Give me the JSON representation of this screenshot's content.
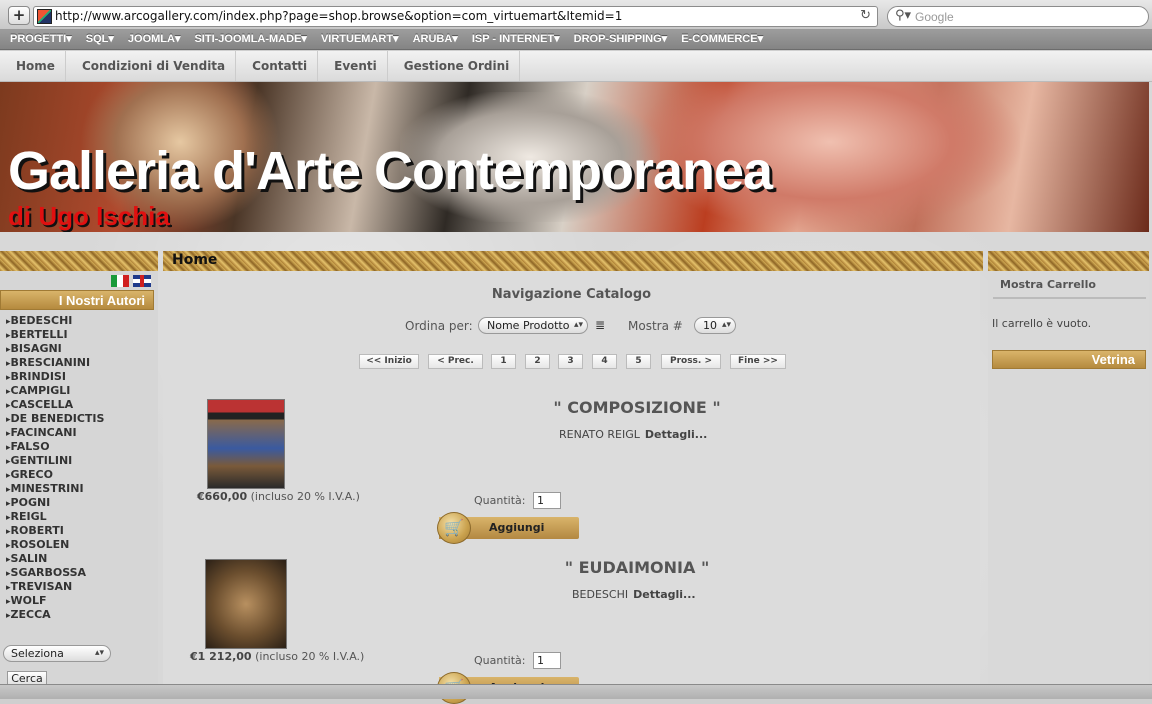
{
  "browser": {
    "url": "http://www.arcogallery.com/index.php?page=shop.browse&option=com_virtuemart&Itemid=1",
    "search_placeholder": "Google",
    "bookmarks": [
      "PROGETTI▾",
      "SQL▾",
      "JOOMLA▾",
      "SITI-JOOMLA-MADE▾",
      "VIRTUEMART▾",
      "ARUBA▾",
      "ISP - INTERNET▾",
      "DROP-SHIPPING▾",
      "E-COMMERCE▾"
    ]
  },
  "nav": [
    "Home",
    "Condizioni di Vendita",
    "Contatti",
    "Eventi",
    "Gestione Ordini"
  ],
  "banner": {
    "title": "Galleria d'Arte Contemporanea",
    "subtitle": "di Ugo Ischia"
  },
  "sidebar": {
    "authors_title": "I Nostri Autori",
    "authors": [
      "BEDESCHI",
      "BERTELLI",
      "BISAGNI",
      "BRESCIANINI",
      "BRINDISI",
      "CAMPIGLI",
      "CASCELLA",
      "DE BENEDICTIS",
      "FACINCANI",
      "FALSO",
      "GENTILINI",
      "GRECO",
      "MINESTRINI",
      "POGNI",
      "REIGL",
      "ROBERTI",
      "ROSOLEN",
      "SALIN",
      "SGARBOSSA",
      "TREVISAN",
      "WOLF",
      "ZECCA"
    ],
    "select_label": "Seleziona",
    "search_button": "Cerca"
  },
  "main": {
    "breadcrumb": "Home",
    "catalog_title": "Navigazione Catalogo",
    "sort_label": "Ordina per:",
    "sort_value": "Nome Prodotto",
    "show_label": "Mostra #",
    "show_value": "10",
    "pagination": [
      "<< Inizio",
      "< Prec.",
      "1",
      "2",
      "3",
      "4",
      "5",
      "Pross. >",
      "Fine >>"
    ],
    "products": [
      {
        "title": "\" COMPOSIZIONE \"",
        "author": "RENATO REIGL",
        "details": "Dettagli...",
        "price": "€660,00",
        "vat": " (incluso 20 % I.V.A.)",
        "qty_label": "Quantità:",
        "qty": "1",
        "add": "Aggiungi"
      },
      {
        "title": "\" EUDAIMONIA \"",
        "author": "BEDESCHI",
        "details": "Dettagli...",
        "price": "€1 212,00",
        "vat": " (incluso 20 % I.V.A.)",
        "qty_label": "Quantità:",
        "qty": "1",
        "add": "Aggiungi"
      }
    ]
  },
  "right": {
    "cart_title": "Mostra Carrello",
    "cart_empty": "Il carrello è vuoto.",
    "vetrina": "Vetrina"
  }
}
